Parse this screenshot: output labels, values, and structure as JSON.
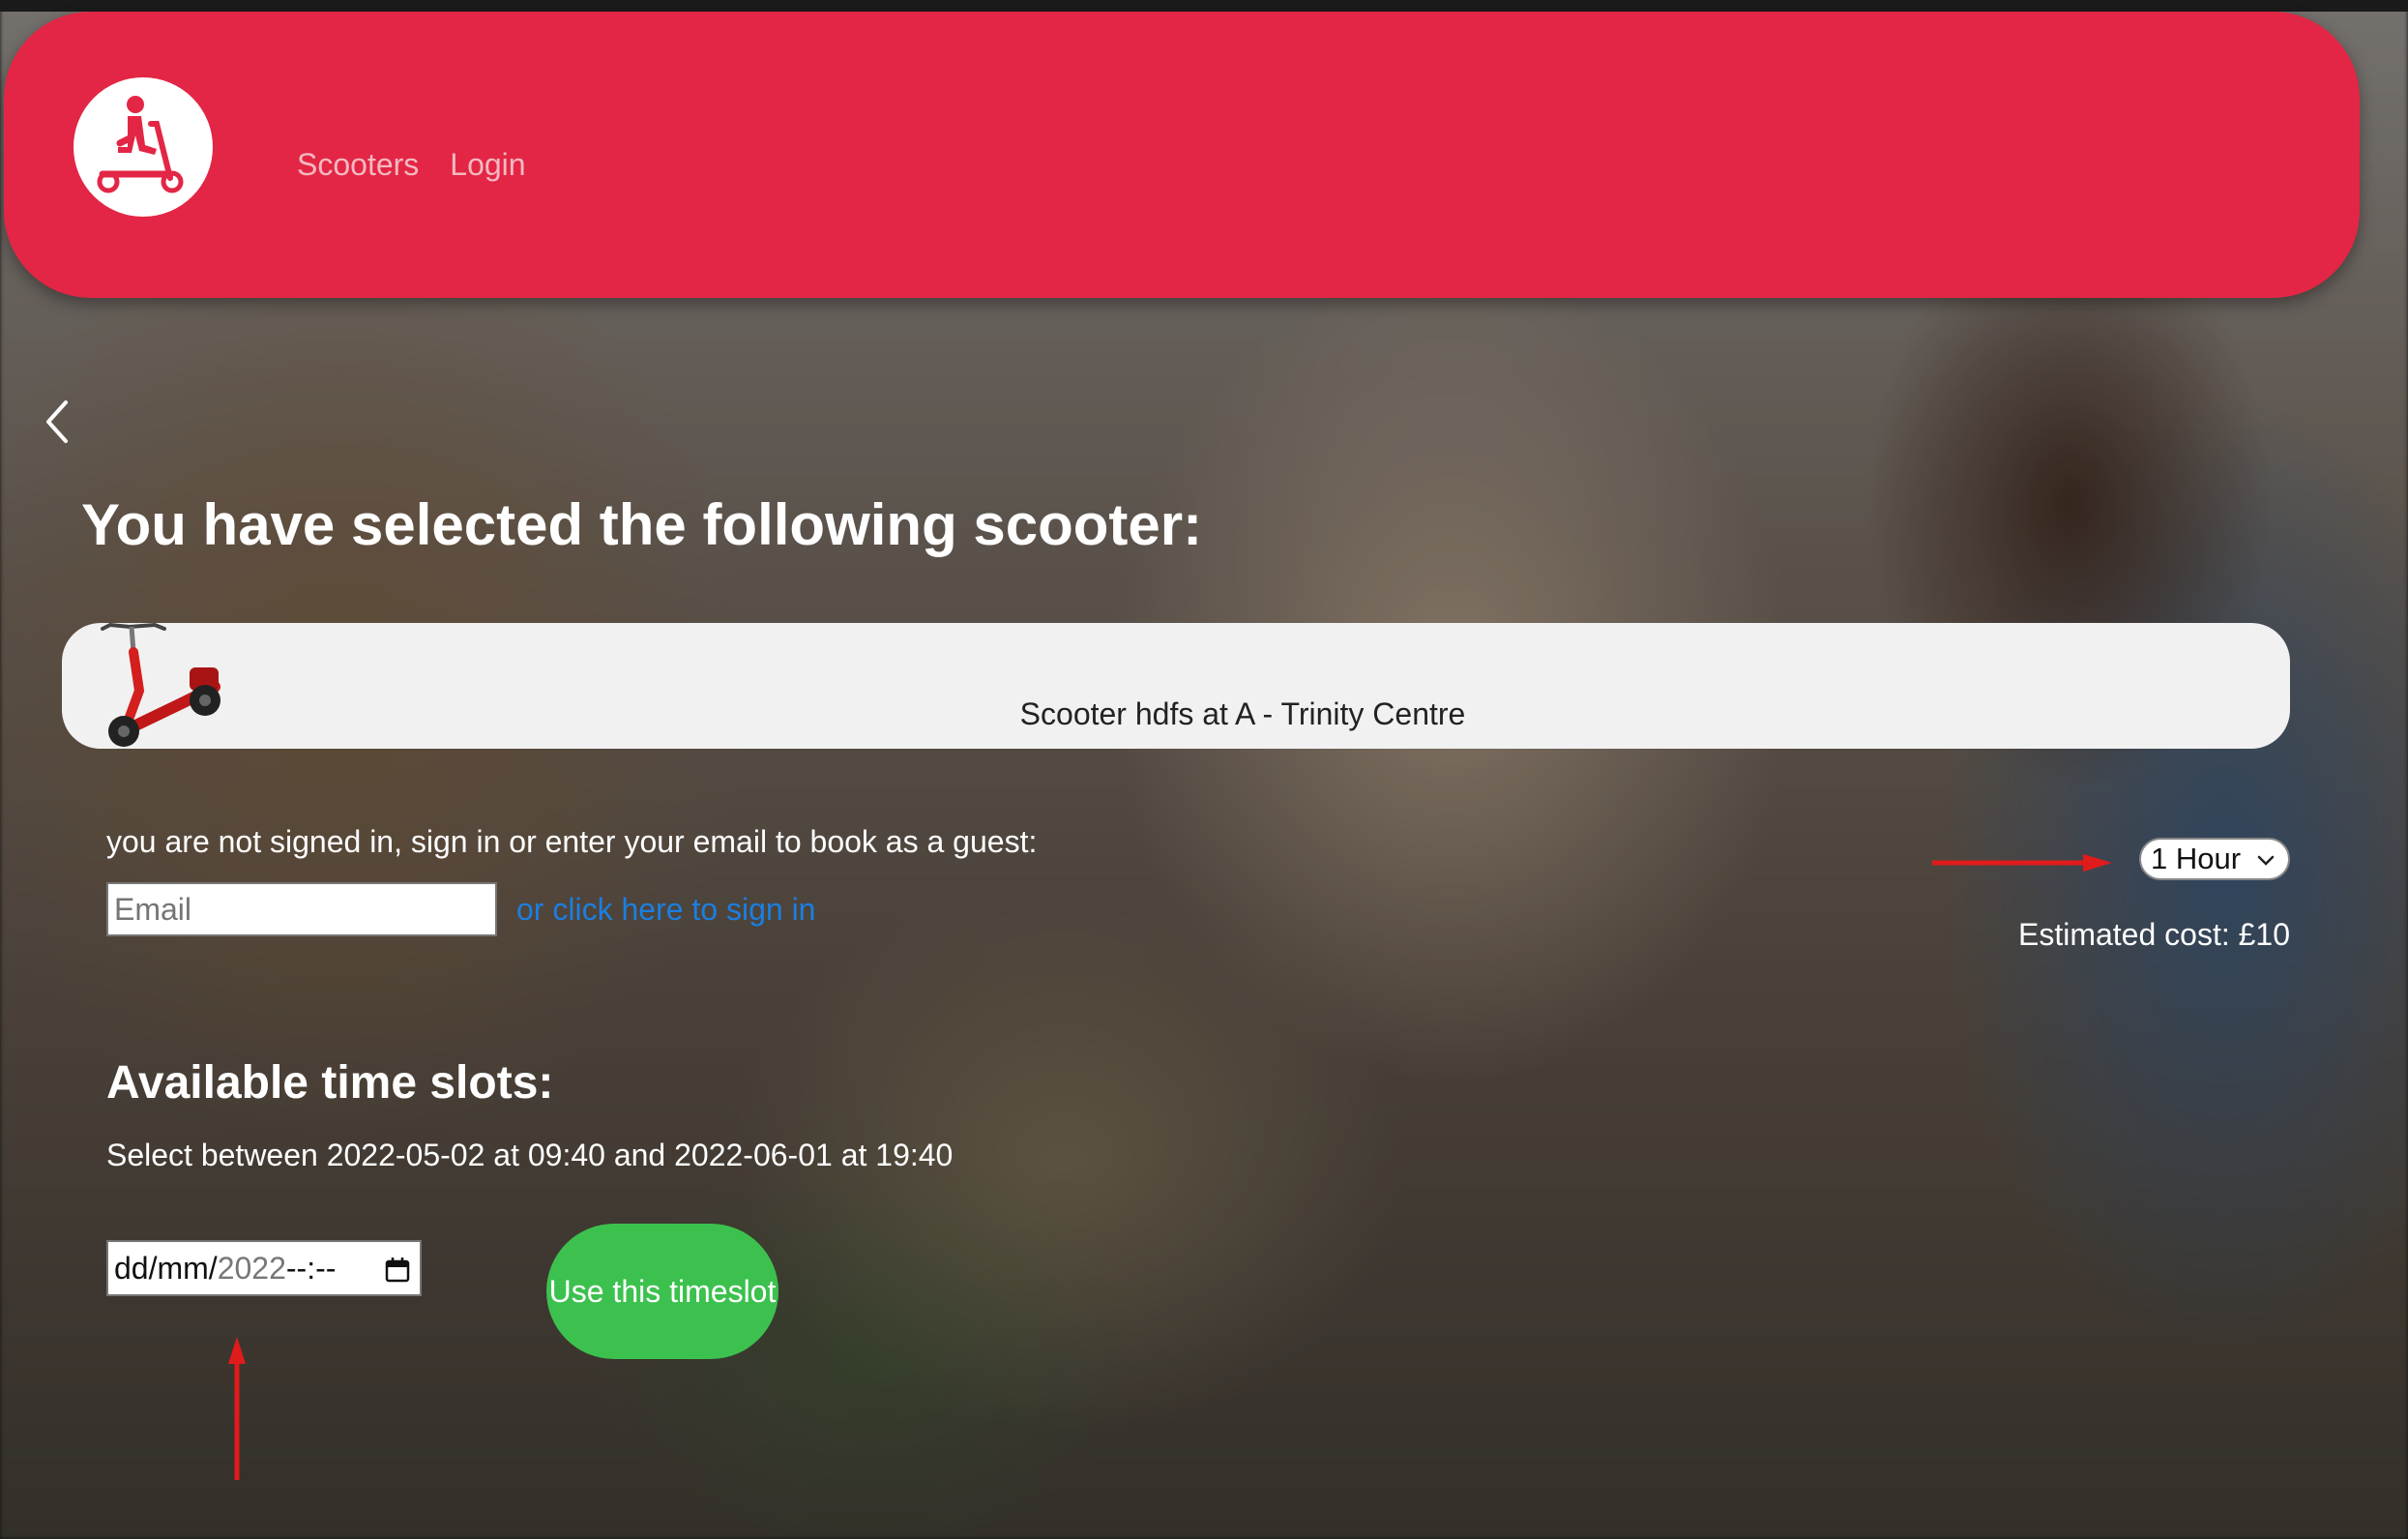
{
  "header": {
    "logo_icon": "scooter-rider-icon",
    "nav": [
      {
        "label": "Scooters"
      },
      {
        "label": "Login"
      }
    ],
    "brand_color": "#e32645"
  },
  "page": {
    "back_icon": "chevron-left-icon",
    "title": "You have selected the following scooter:"
  },
  "scooter": {
    "image_icon": "red-scooter-icon",
    "name": "Scooter hdfs at A - Trinity Centre"
  },
  "guest": {
    "message": "you are not signed in, sign in or enter your email to book as a guest:",
    "email_placeholder": "Email",
    "signin_link": "or click here to sign in"
  },
  "booking": {
    "duration_selected": "1 Hour",
    "estimated_cost": "Estimated cost: £10"
  },
  "slots": {
    "title": "Available time slots:",
    "range_text": "Select between 2022-05-02 at 09:40 and 2022-06-01 at 19:40",
    "datetime_prefix": "dd/mm/",
    "datetime_year": "2022",
    "datetime_time": " --:--",
    "use_button": "Use this timeslot"
  },
  "annotations": {
    "arrow_color": "#e01b1b"
  }
}
